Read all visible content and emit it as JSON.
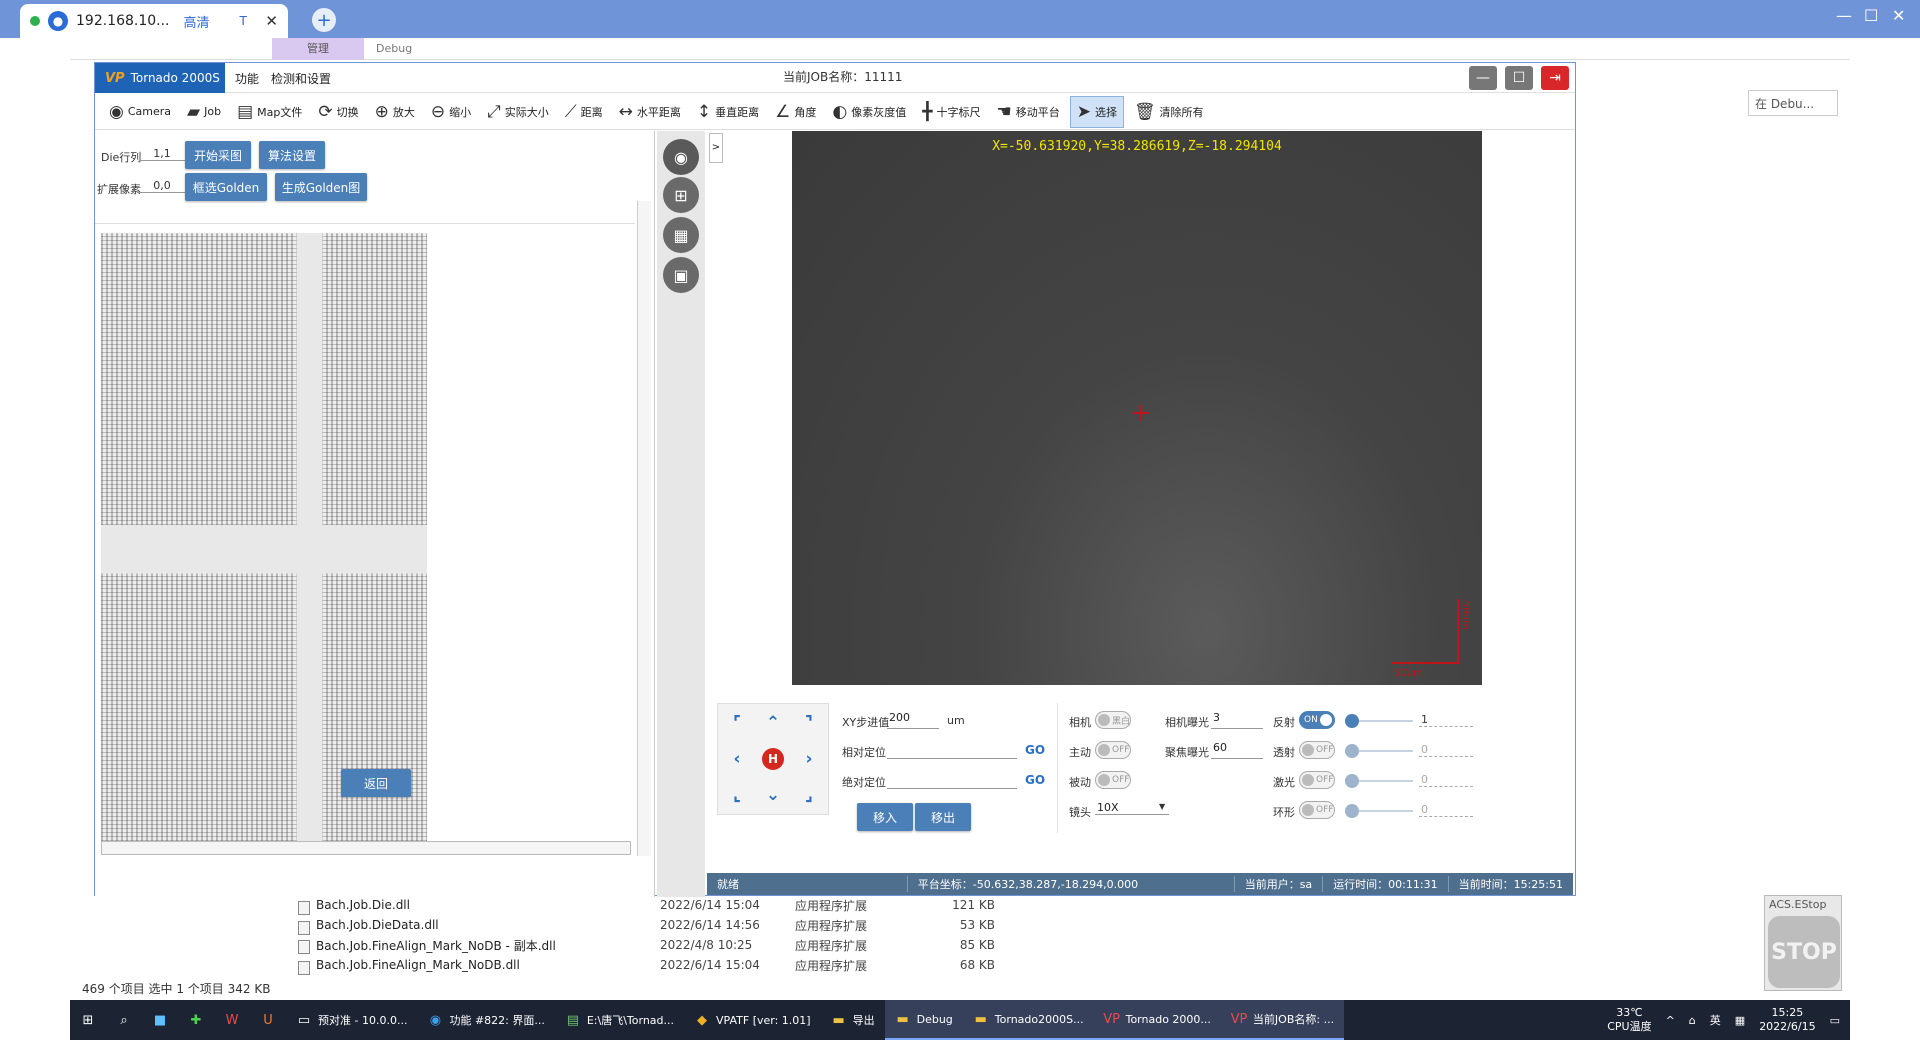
{
  "browser": {
    "tab_title": "192.168.10...",
    "tab_hd": "高清",
    "tab_t": "T"
  },
  "explorer": {
    "manage_tab": "管理",
    "debug_tab": "Debug",
    "search_placeholder": "在 Debu...",
    "files": [
      {
        "name": "Bach.Job.Die.dll",
        "date": "2022/6/14 15:04",
        "type": "应用程序扩展",
        "size": "121 KB"
      },
      {
        "name": "Bach.Job.DieData.dll",
        "date": "2022/6/14 14:56",
        "type": "应用程序扩展",
        "size": "53 KB"
      },
      {
        "name": "Bach.Job.FineAlign_Mark_NoDB - 副本.dll",
        "date": "2022/4/8 10:25",
        "type": "应用程序扩展",
        "size": "85 KB"
      },
      {
        "name": "Bach.Job.FineAlign_Mark_NoDB.dll",
        "date": "2022/6/14 15:04",
        "type": "应用程序扩展",
        "size": "68 KB"
      }
    ],
    "status": "469 个项目    选中 1 个项目  342 KB"
  },
  "app": {
    "brand": "Tornado 2000S",
    "brand_logo": "VP",
    "menu_func": "功能",
    "menu_detect": "检测和设置",
    "job_name": "当前JOB名称：11111",
    "toolbar": [
      {
        "label": "Camera",
        "icon": "camera-icon"
      },
      {
        "label": "Job",
        "icon": "folder-icon"
      },
      {
        "label": "Map文件",
        "icon": "file-icon"
      },
      {
        "label": "切换",
        "icon": "switch-icon"
      },
      {
        "label": "放大",
        "icon": "zoom-in-icon"
      },
      {
        "label": "缩小",
        "icon": "zoom-out-icon"
      },
      {
        "label": "实际大小",
        "icon": "fit-icon"
      },
      {
        "label": "距离",
        "icon": "ruler-icon"
      },
      {
        "label": "水平距离",
        "icon": "h-distance-icon"
      },
      {
        "label": "垂直距离",
        "icon": "v-distance-icon"
      },
      {
        "label": "角度",
        "icon": "angle-icon"
      },
      {
        "label": "像素灰度值",
        "icon": "gray-icon"
      },
      {
        "label": "十字标尺",
        "icon": "crosshair-icon"
      },
      {
        "label": "移动平台",
        "icon": "hand-icon"
      },
      {
        "label": "选择",
        "icon": "cursor-icon"
      },
      {
        "label": "清除所有",
        "icon": "trash-icon"
      }
    ],
    "left": {
      "die_row_label": "Die行列",
      "die_row_value": "1,1",
      "expand_label": "扩展像素",
      "expand_value": "0,0",
      "btn_start": "开始采图",
      "btn_algo": "算法设置",
      "btn_select_golden": "框选Golden",
      "btn_gen_golden": "生成Golden图",
      "btn_return": "返回"
    },
    "camera": {
      "coords": "X=-50.631920,Y=38.286619,Z=-18.294104",
      "scale_h": "50um",
      "scale_v": "50um",
      "expand": ">"
    },
    "controls": {
      "xy_step_label": "XY步进值",
      "xy_step_value": "200",
      "xy_step_unit": "um",
      "rel_pos_label": "相对定位",
      "abs_pos_label": "绝对定位",
      "go": "GO",
      "move_in": "移入",
      "move_out": "移出",
      "camera_label": "相机",
      "camera_toggle": "黑白",
      "active_label": "主动",
      "active_toggle": "OFF",
      "passive_label": "被动",
      "passive_toggle": "OFF",
      "lens_label": "镜头",
      "lens_value": "10X",
      "cam_exposure_label": "相机曝光",
      "cam_exposure_value": "3",
      "focus_exposure_label": "聚焦曝光",
      "focus_exposure_value": "60",
      "reflect_label": "反射",
      "reflect_toggle": "ON",
      "reflect_value": "1",
      "transmit_label": "透射",
      "transmit_toggle": "OFF",
      "transmit_value": "0",
      "laser_label": "激光",
      "laser_toggle": "OFF",
      "laser_value": "0",
      "ring_label": "环形",
      "ring_toggle": "OFF",
      "ring_value": "0"
    },
    "status": {
      "ready": "就绪",
      "platform": "平台坐标：-50.632,38.287,-18.294,0.000",
      "user": "当前用户：sa",
      "runtime": "运行时间：00:11:31",
      "now": "当前时间：15:25:51"
    }
  },
  "estop": {
    "title": "ACS.EStop",
    "label": "STOP"
  },
  "taskbar": {
    "items": [
      {
        "label": "预对准 - 10.0.0...",
        "icon": "monitor-icon"
      },
      {
        "label": "功能 #822: 界面...",
        "icon": "edge-icon"
      },
      {
        "label": "E:\\唐飞\\Tornad...",
        "icon": "notepad-icon"
      },
      {
        "label": "VPATF [ver: 1.01]",
        "icon": "app-icon"
      },
      {
        "label": "导出",
        "icon": "folder-icon"
      },
      {
        "label": "Debug",
        "icon": "folder-icon"
      },
      {
        "label": "Tornado2000S...",
        "icon": "folder-icon"
      },
      {
        "label": "Tornado 2000...",
        "icon": "vp-icon"
      },
      {
        "label": "当前JOB名称: ...",
        "icon": "vp-icon"
      }
    ],
    "temp": "33℃",
    "temp_label": "CPU温度",
    "ime": "英",
    "time": "15:25",
    "date": "2022/6/15"
  }
}
